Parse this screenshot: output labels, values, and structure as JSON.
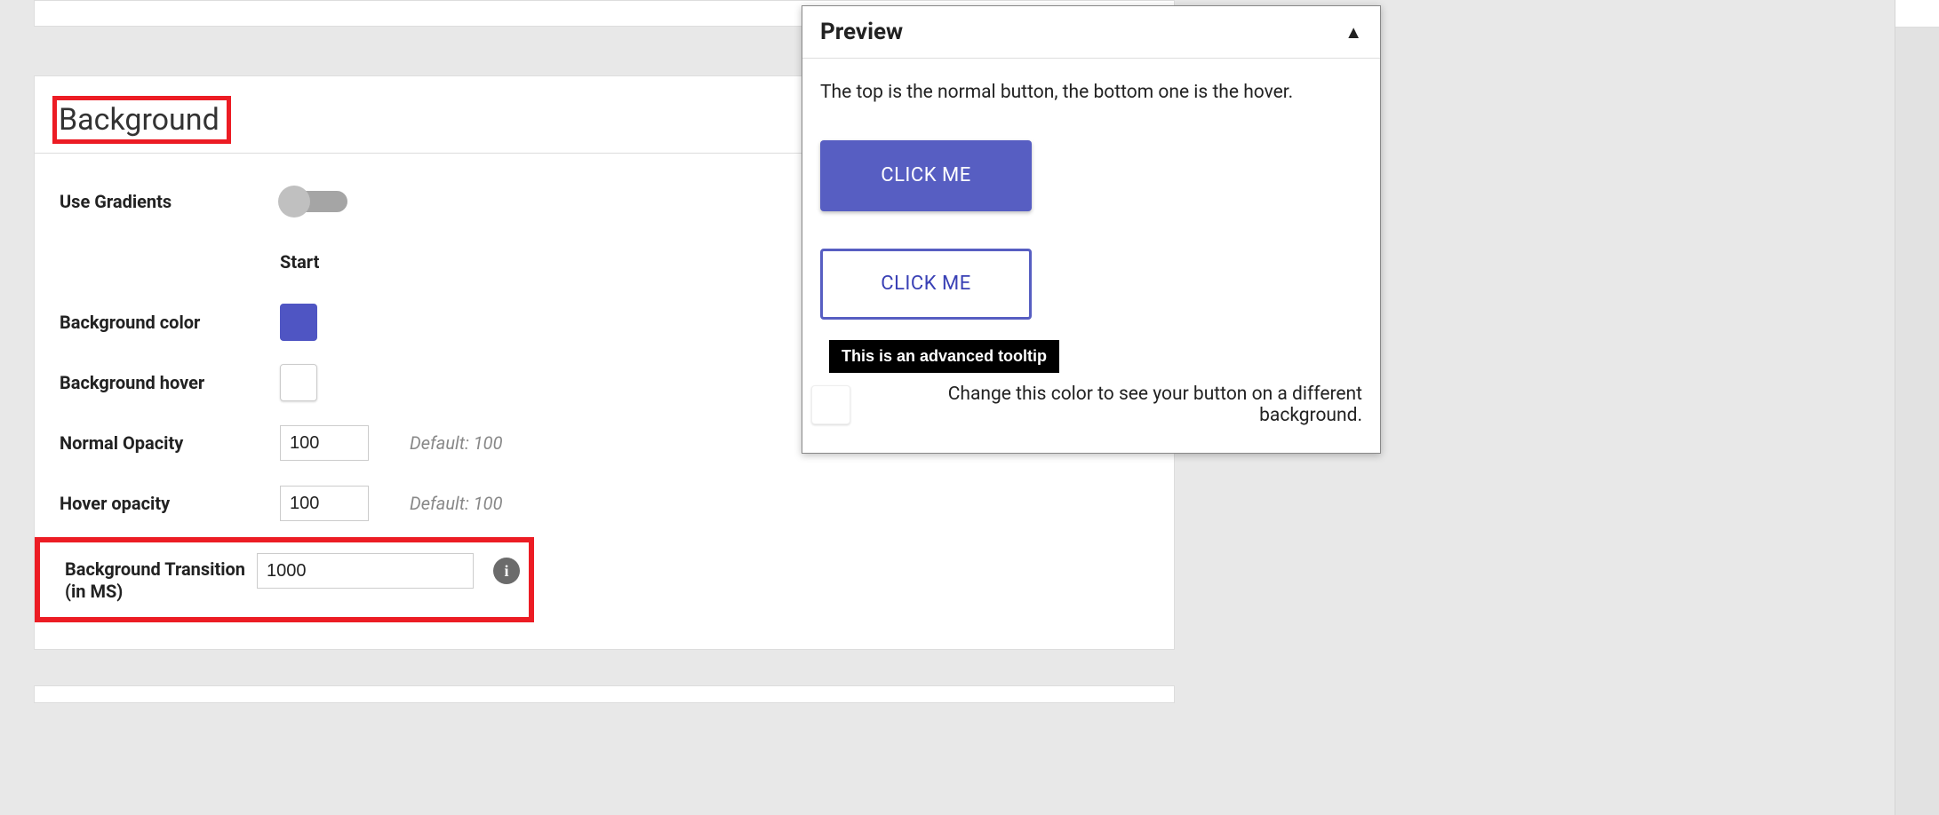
{
  "section": {
    "title": "Background",
    "startHeader": "Start"
  },
  "fields": {
    "useGradients": {
      "label": "Use Gradients"
    },
    "bgColor": {
      "label": "Background color",
      "value": "#4f55c3"
    },
    "bgHover": {
      "label": "Background hover",
      "value": "#ffffff"
    },
    "normalOpacity": {
      "label": "Normal Opacity",
      "value": "100",
      "hint": "Default: 100"
    },
    "hoverOpacity": {
      "label": "Hover opacity",
      "value": "100",
      "hint": "Default: 100"
    },
    "transition": {
      "label": "Background Transition (in MS)",
      "value": "1000"
    }
  },
  "preview": {
    "title": "Preview",
    "desc": "The top is the normal button, the bottom one is the hover.",
    "button1": "CLICK ME",
    "button2": "CLICK ME",
    "tooltip": "This is an advanced tooltip",
    "foot": "Change this color to see your button on a different background."
  },
  "icons": {
    "info": "i",
    "caretUp": "▲"
  }
}
